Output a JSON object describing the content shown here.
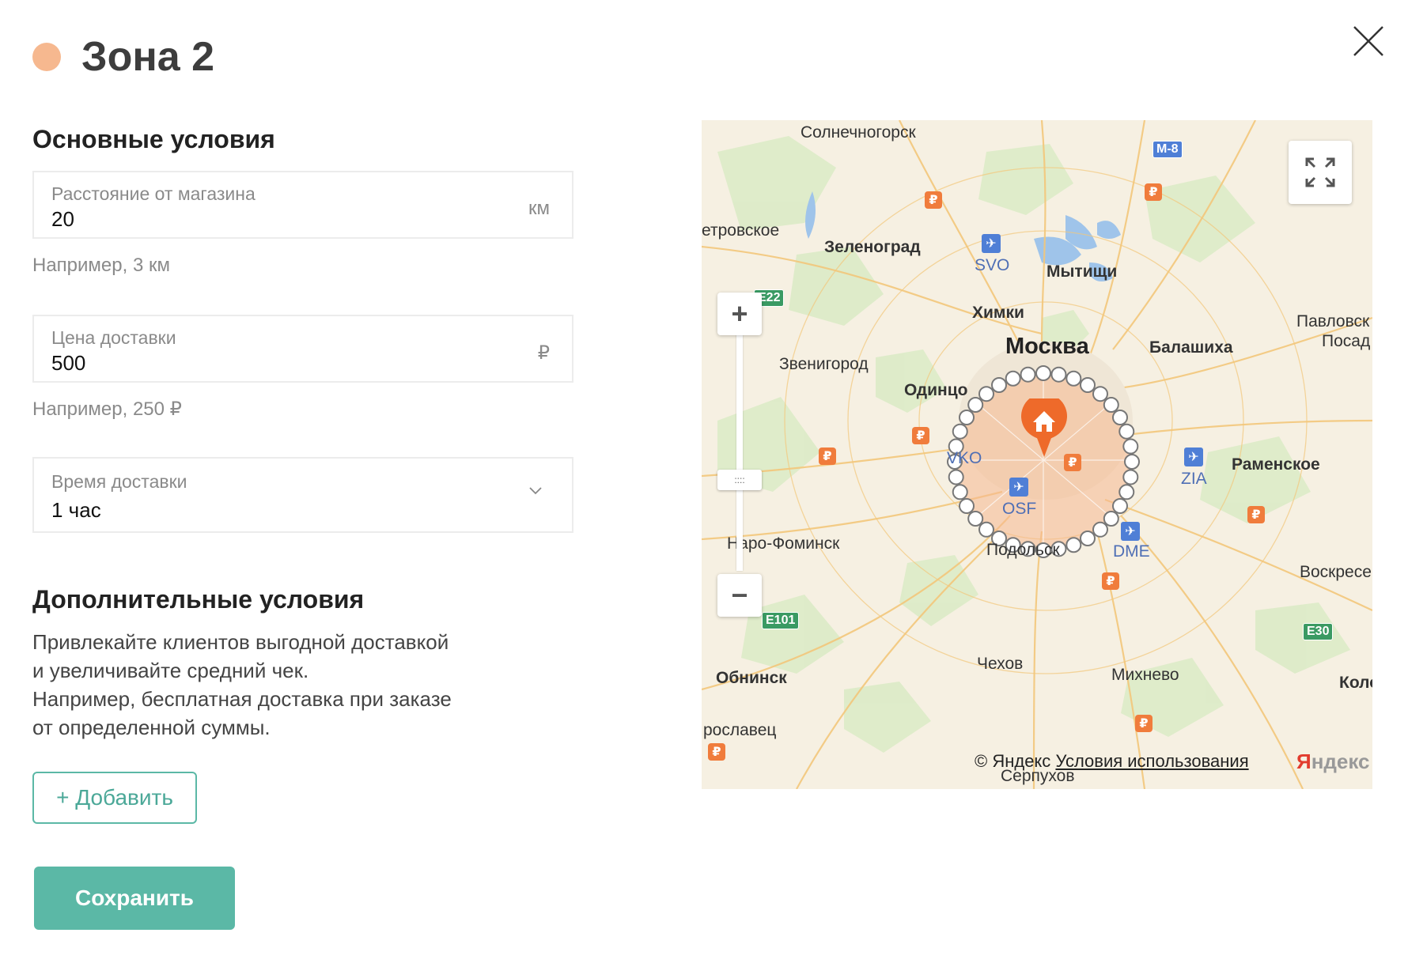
{
  "header": {
    "title": "Зона 2",
    "zone_color": "#f6b88f"
  },
  "main_conditions": {
    "title": "Основные условия",
    "distance": {
      "label": "Расстояние от магазина",
      "value": "20",
      "unit": "км",
      "hint": "Например, 3 км"
    },
    "price": {
      "label": "Цена доставки",
      "value": "500",
      "unit": "₽",
      "hint": "Например, 250 ₽"
    },
    "time": {
      "label": "Время доставки",
      "value": "1 час"
    }
  },
  "extra_conditions": {
    "title": "Дополнительные условия",
    "description_lines": [
      "Привлекайте клиентов выгодной доставкой",
      "и увеличивайте средний чек.",
      "Например, бесплатная доставка при заказе",
      "от определенной суммы."
    ],
    "add_label": "+ Добавить"
  },
  "save_label": "Сохранить",
  "map": {
    "cities": {
      "solnechnogorsk": "Солнечногорск",
      "petrovskoe": "етровское",
      "zelenograd": "Зеленоград",
      "mytishchi": "Мытищи",
      "khimki": "Химки",
      "moskva": "Москва",
      "balashikha": "Балашиха",
      "pavlovsk": "Павловск",
      "posad": "Посад",
      "zvenigorod": "Звенигород",
      "odintsovo": "Одинцо",
      "ramenskoe": "Раменское",
      "naro_fominsk": "Наро-Фоминск",
      "podolsk": "Подольск",
      "voskresensk": "Воскресе",
      "chekhov": "Чехов",
      "obninsk": "Обнинск",
      "mikhnevo": "Михнево",
      "kolomna": "Коло",
      "yaroslavets": "рославец",
      "serpukhov": "Серпухов"
    },
    "airports": {
      "svo": "SVO",
      "vko": "VKO",
      "osf": "OSF",
      "zia": "ZIA",
      "dme": "DME"
    },
    "highways": {
      "m8": "М-8",
      "e22": "E22",
      "e101": "E101",
      "e30": "E30"
    },
    "copyright": "© Яндекс",
    "terms": "Условия использования",
    "logo_ya": "Я",
    "logo_ndex": "ндекс",
    "zoom_in": "+",
    "zoom_out": "−",
    "handle": "::::",
    "rub_sign": "₽",
    "plane_glyph": "✈"
  }
}
